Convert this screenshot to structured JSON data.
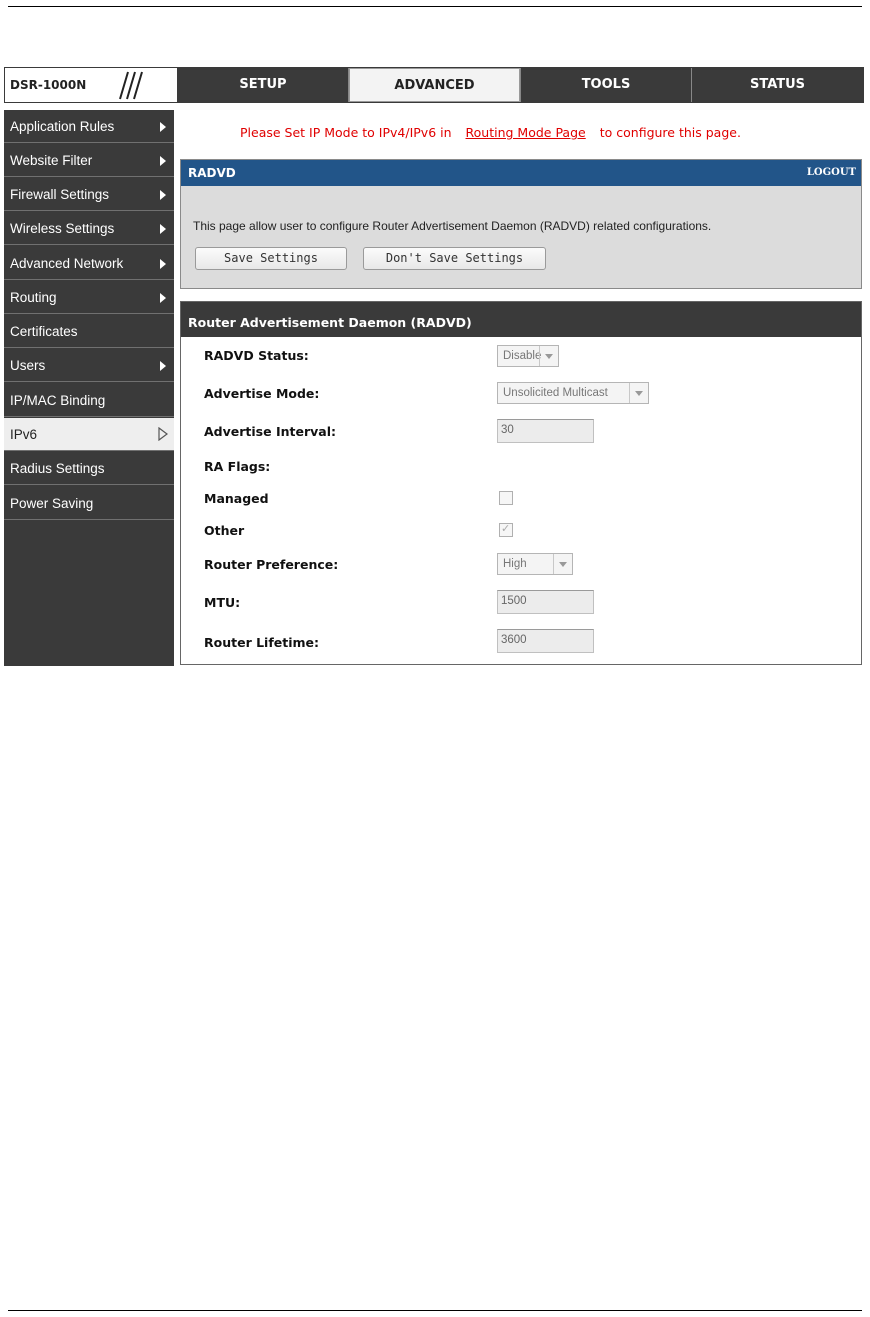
{
  "brand": "DSR-1000N",
  "tabs": [
    {
      "label": "SETUP"
    },
    {
      "label": "ADVANCED"
    },
    {
      "label": "TOOLS"
    },
    {
      "label": "STATUS"
    }
  ],
  "active_tab": "ADVANCED",
  "sidebar": {
    "items": [
      {
        "label": "Application Rules"
      },
      {
        "label": "Website Filter"
      },
      {
        "label": "Firewall Settings"
      },
      {
        "label": "Wireless Settings"
      },
      {
        "label": "Advanced Network"
      },
      {
        "label": "Routing"
      },
      {
        "label": "Certificates"
      },
      {
        "label": "Users"
      },
      {
        "label": "IP/MAC Binding"
      },
      {
        "label": "IPv6"
      },
      {
        "label": "Radius Settings"
      },
      {
        "label": "Power Saving"
      }
    ],
    "active": "IPv6"
  },
  "notice": {
    "prefix": "Please Set IP Mode to IPv4/IPv6 in",
    "link": "Routing Mode Page",
    "suffix": "to configure this page."
  },
  "panel": {
    "title": "RADVD",
    "logout": "LOGOUT",
    "description": "This page allow user to configure Router Advertisement Daemon (RADVD) related configurations.",
    "save_label": "Save Settings",
    "dont_save_label": "Don't Save Settings"
  },
  "section": {
    "title": "Router Advertisement Daemon (RADVD)",
    "fields": {
      "radvd_status": {
        "label": "RADVD Status:",
        "value": "Disable"
      },
      "advertise_mode": {
        "label": "Advertise Mode:",
        "value": "Unsolicited Multicast"
      },
      "advertise_interval": {
        "label": "Advertise Interval:",
        "value": "30"
      },
      "ra_flags": {
        "label": "RA Flags:"
      },
      "managed": {
        "label": "Managed",
        "checked": false
      },
      "other": {
        "label": "Other",
        "checked": true
      },
      "router_preference": {
        "label": "Router Preference:",
        "value": "High"
      },
      "mtu": {
        "label": "MTU:",
        "value": "1500"
      },
      "router_lifetime": {
        "label": "Router Lifetime:",
        "value": "3600"
      }
    }
  },
  "colors": {
    "nav_background": "#3a3a3a",
    "panel_header": "#225589",
    "panel_body": "#dcdcdc",
    "notice_text": "#e00000"
  }
}
